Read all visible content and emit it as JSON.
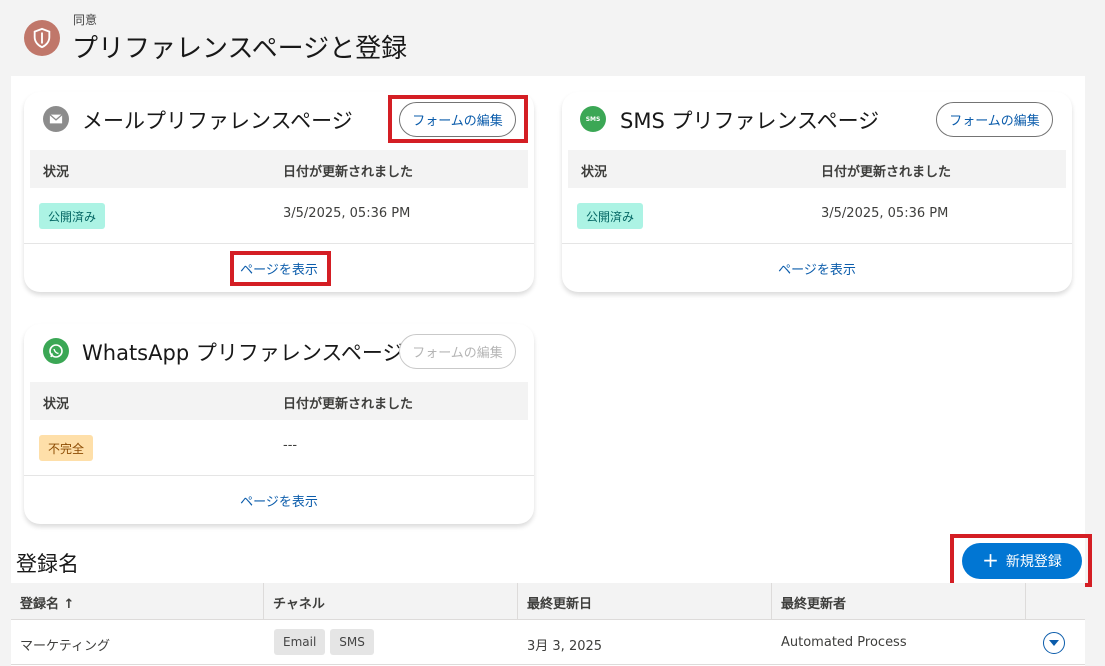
{
  "header": {
    "eyebrow": "同意",
    "title": "プリファレンスページと登録"
  },
  "cards": {
    "email": {
      "title": "メールプリファレンスページ",
      "edit_label": "フォームの編集",
      "col_status": "状況",
      "col_date": "日付が更新されました",
      "status": "公開済み",
      "date": "3/5/2025, 05:36 PM",
      "view_label": "ページを表示"
    },
    "sms": {
      "title": "SMS プリファレンスページ",
      "edit_label": "フォームの編集",
      "col_status": "状況",
      "col_date": "日付が更新されました",
      "status": "公開済み",
      "date": "3/5/2025, 05:36 PM",
      "view_label": "ページを表示",
      "icon_text": "SMS"
    },
    "whatsapp": {
      "title": "WhatsApp プリファレンスページ",
      "edit_label": "フォームの編集",
      "col_status": "状況",
      "col_date": "日付が更新されました",
      "status": "不完全",
      "date": "---",
      "view_label": "ページを表示"
    }
  },
  "registrations": {
    "title": "登録名",
    "new_label": "新規登録",
    "columns": [
      "登録名 ↑",
      "チャネル",
      "最終更新日",
      "最終更新者"
    ],
    "rows": [
      {
        "name": "マーケティング",
        "channels": [
          "Email",
          "SMS"
        ],
        "updated": "3月 3, 2025",
        "updated_by": "Automated Process"
      }
    ]
  },
  "colors": {
    "brand": "#0176d3",
    "highlight": "#d41e24",
    "published_bg": "#acf3e4",
    "incomplete_bg": "#fedfa9"
  },
  "icons": {
    "logo": "shield-icon",
    "email": "envelope-icon",
    "sms": "sms-icon",
    "whatsapp": "whatsapp-icon",
    "new": "plus-icon",
    "row_action": "chevron-down-icon"
  }
}
